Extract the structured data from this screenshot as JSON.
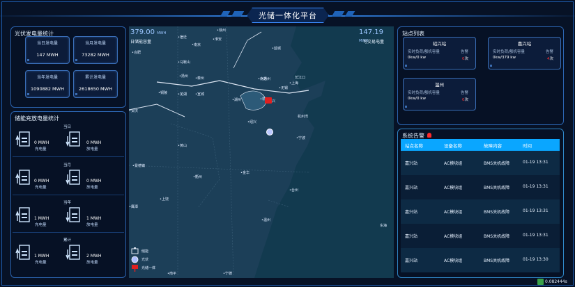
{
  "header": {
    "title": "光储一体化平台"
  },
  "pv_panel": {
    "title": "光伏发电量统计",
    "stats": [
      {
        "label": "当日发电量",
        "value": "147 MWH"
      },
      {
        "label": "当月发电量",
        "value": "73282 MWH"
      },
      {
        "label": "当年发电量",
        "value": "1090882 MWH"
      },
      {
        "label": "累计发电量",
        "value": "2618650 MWH"
      }
    ]
  },
  "storage_panel": {
    "title": "储能充放电量统计",
    "rows": [
      {
        "period": "当日",
        "charge_value": "0 MWH",
        "charge_label": "充电量",
        "discharge_value": "0 MWH",
        "discharge_label": "放电量"
      },
      {
        "period": "当月",
        "charge_value": "0 MWH",
        "charge_label": "充电量",
        "discharge_value": "0 MWH",
        "discharge_label": "放电量"
      },
      {
        "period": "当年",
        "charge_value": "1 MWH",
        "charge_label": "充电量",
        "discharge_value": "1 MWH",
        "discharge_label": "放电量"
      },
      {
        "period": "累计",
        "charge_value": "1 MWH",
        "charge_label": "充电量",
        "discharge_value": "2 MWH",
        "discharge_label": "放电量"
      }
    ]
  },
  "map": {
    "left_value": "379.00",
    "left_unit": "MWH",
    "left_caption": "日储能容量",
    "right_value": "147.19",
    "right_unit": "MWH",
    "right_caption": "可交易电量",
    "places": [
      "徐州",
      "宿迁",
      "淮安",
      "盐城",
      "合肥",
      "马鞍山",
      "南京",
      "扬州",
      "泰州",
      "南通",
      "长江口",
      "无锡",
      "苏州",
      "上海",
      "安庆",
      "铜陵",
      "芜湖",
      "宣城",
      "湖州",
      "嘉兴",
      "杭州湾",
      "杭州",
      "宁波",
      "绍兴",
      "景德镇",
      "黄山",
      "衢州",
      "金华",
      "台州",
      "东海",
      "温州",
      "上饶",
      "鹰潭",
      "南平",
      "宁德"
    ],
    "legend": [
      {
        "icon": "storage-icon",
        "label": "储能"
      },
      {
        "icon": "pv-icon",
        "label": "光伏"
      },
      {
        "icon": "integrated-icon",
        "label": "光储一体"
      }
    ]
  },
  "stations_panel": {
    "title": "站点列表",
    "cards": [
      {
        "name": "绍兴站",
        "cap_label": "实时负荷/额机容量",
        "alarm_label": "告警",
        "cap_value": "0kw/0 kw",
        "alarm_value": "0",
        "alarm_unit": "次"
      },
      {
        "name": "嘉兴站",
        "cap_label": "实时负荷/额机容量",
        "alarm_label": "告警",
        "cap_value": "0kw/379 kw",
        "alarm_value": "4",
        "alarm_unit": "次"
      },
      {
        "name": "温州",
        "cap_label": "实时负荷/额机容量",
        "alarm_label": "告警",
        "cap_value": "0kw/0 kw",
        "alarm_value": "0",
        "alarm_unit": "次"
      }
    ]
  },
  "alarm_panel": {
    "title": "系统告警",
    "columns": [
      "站点名称",
      "设备名称",
      "故障内容",
      "时间"
    ],
    "rows": [
      [
        "嘉兴站",
        "AC模块组",
        "BMS关机故障",
        "01-19 13:31"
      ],
      [
        "嘉兴站",
        "AC模块组",
        "BMS关机故障",
        "01-19 13:31"
      ],
      [
        "嘉兴站",
        "AC模块组",
        "BMS关机故障",
        "01-19 13:31"
      ],
      [
        "嘉兴站",
        "AC模块组",
        "BMS关机故障",
        "01-19 13:31"
      ],
      [
        "嘉兴站",
        "AC模块组",
        "BMS关机故障",
        "01-19 13:30"
      ]
    ]
  },
  "badge": {
    "value": "0.082444s"
  },
  "colors": {
    "accent": "#0aa6ff",
    "alarm": "#ff3030",
    "border": "#2b64b0",
    "map": "#123a4f"
  }
}
